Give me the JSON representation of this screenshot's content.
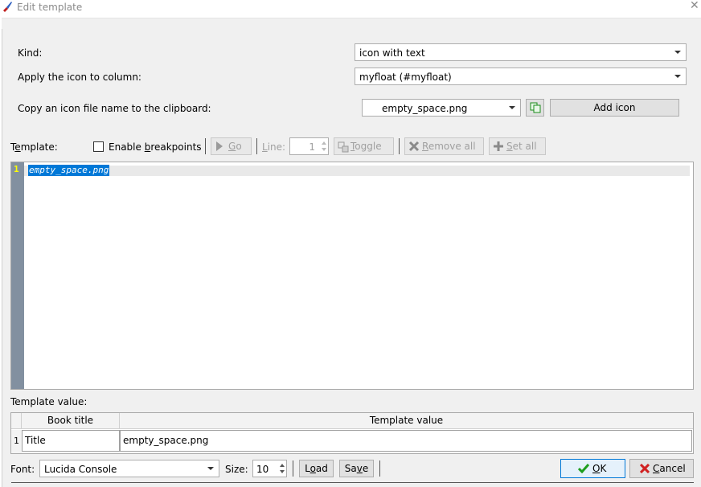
{
  "window": {
    "title": "Edit template",
    "close_glyph": "✕"
  },
  "form": {
    "kind_label": "Kind:",
    "kind_value": "icon with text",
    "column_label": "Apply the icon to column:",
    "column_value": "myfloat (#myfloat)",
    "copy_label": "Copy an icon file name to the clipboard:",
    "icon_file_value": "empty_space.png",
    "add_icon_label": "Add icon"
  },
  "toolbar": {
    "template_label_pre": "T",
    "template_label_u": "e",
    "template_label_post": "mplate:",
    "breakpoints_pre": "Enable ",
    "breakpoints_u": "b",
    "breakpoints_post": "reakpoints",
    "go_u": "G",
    "go_post": "o",
    "line_u": "L",
    "line_post": "ine:",
    "line_value": "1",
    "toggle_u": "T",
    "toggle_post": "oggle",
    "remove_all_u": "R",
    "remove_all_post": "emove all",
    "set_all_u": "S",
    "set_all_post": "et all"
  },
  "editor": {
    "line_number": "1",
    "code": "empty_space.png"
  },
  "template_value": {
    "label": "Template value:",
    "headers": [
      "Book title",
      "Template value"
    ],
    "rows": [
      {
        "index": "1",
        "book_title": "Title",
        "value": "empty_space.png"
      }
    ]
  },
  "footer": {
    "font_label": "Font:",
    "font_value": "Lucida Console",
    "size_label": "Size:",
    "size_value": "10",
    "load_pre": "L",
    "load_u": "o",
    "load_post": "ad",
    "save_pre": "Sa",
    "save_u": "v",
    "save_post": "e",
    "ok_u": "O",
    "ok_post": "K",
    "cancel_u": "C",
    "cancel_post": "ancel"
  },
  "colors": {
    "gutter": "#8290a0",
    "line_number": "#ffff00",
    "selection": "#0078d7",
    "ok_check": "#1e9e1e",
    "cancel_x": "#d02020"
  }
}
